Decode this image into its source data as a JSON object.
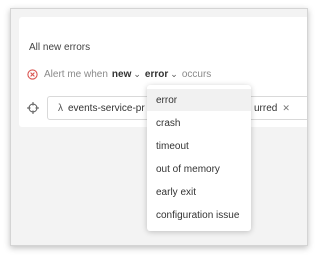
{
  "card": {
    "title": "All new errors"
  },
  "alert": {
    "prefix": "Alert me when",
    "condition": "new",
    "type": "error",
    "suffix": "occurs"
  },
  "target": {
    "tag_text_left": "events-service-pr",
    "tag_text_right": "urred"
  },
  "dropdown": {
    "selected": "error",
    "options": [
      "error",
      "crash",
      "timeout",
      "out of memory",
      "early exit",
      "configuration issue"
    ]
  }
}
